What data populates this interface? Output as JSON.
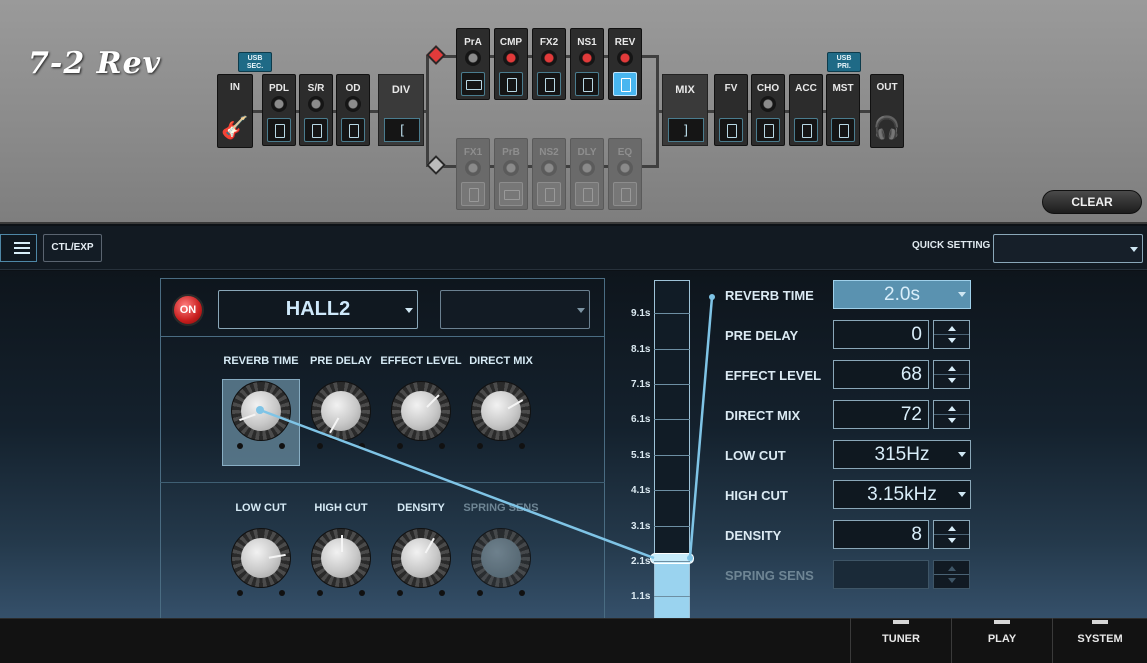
{
  "title": "7-2 Rev",
  "chain": {
    "in": "IN",
    "usb_sec": "USB SEC.",
    "usb_pri": "USB PRI.",
    "pdl": "PDL",
    "sr": "S/R",
    "od": "OD",
    "div": "DIV",
    "pra": "PrA",
    "cmp": "CMP",
    "fx2": "FX2",
    "ns1": "NS1",
    "rev": "REV",
    "fx1": "FX1",
    "prb": "PrB",
    "ns2": "NS2",
    "dly": "DLY",
    "eq": "EQ",
    "mix": "MIX",
    "fv": "FV",
    "cho": "CHO",
    "acc": "ACC",
    "mst": "MST",
    "out": "OUT"
  },
  "clear_label": "CLEAR",
  "toolbar": {
    "ctl_exp": "CTL/EXP",
    "quick_setting": "QUICK SETTING",
    "quick_setting_value": ""
  },
  "effect": {
    "on_label": "ON",
    "type": "HALL2",
    "sub_type": "",
    "knobs": [
      {
        "label": "REVERB TIME",
        "enabled": true
      },
      {
        "label": "PRE DELAY",
        "enabled": true
      },
      {
        "label": "EFFECT LEVEL",
        "enabled": true
      },
      {
        "label": "DIRECT MIX",
        "enabled": true
      },
      {
        "label": "LOW CUT",
        "enabled": true
      },
      {
        "label": "HIGH CUT",
        "enabled": true
      },
      {
        "label": "DENSITY",
        "enabled": true
      },
      {
        "label": "SPRING SENS",
        "enabled": false
      }
    ]
  },
  "slider": {
    "ticks": [
      "9.1s",
      "8.1s",
      "7.1s",
      "6.1s",
      "5.1s",
      "4.1s",
      "3.1s",
      "2.1s",
      "1.1s"
    ],
    "value": "2.0s"
  },
  "params": [
    {
      "label": "REVERB TIME",
      "value": "2.0s",
      "kind": "select"
    },
    {
      "label": "PRE DELAY",
      "value": "0",
      "kind": "stepper"
    },
    {
      "label": "EFFECT LEVEL",
      "value": "68",
      "kind": "stepper"
    },
    {
      "label": "DIRECT MIX",
      "value": "72",
      "kind": "stepper"
    },
    {
      "label": "LOW CUT",
      "value": "315Hz",
      "kind": "dropdown"
    },
    {
      "label": "HIGH CUT",
      "value": "3.15kHz",
      "kind": "dropdown"
    },
    {
      "label": "DENSITY",
      "value": "8",
      "kind": "stepper"
    },
    {
      "label": "SPRING SENS",
      "value": "",
      "kind": "disabled"
    }
  ],
  "nav": {
    "tuner": "TUNER",
    "play": "PLAY",
    "system": "SYSTEM"
  }
}
